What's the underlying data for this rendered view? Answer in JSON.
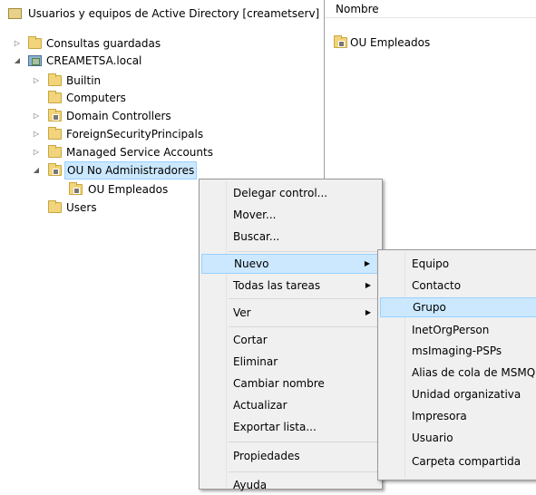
{
  "tree": {
    "root": "Usuarios y equipos de Active Directory [creametserv]",
    "saved_queries": "Consultas guardadas",
    "domain": "CREAMETSA.local",
    "builtin": "Builtin",
    "computers": "Computers",
    "domain_controllers": "Domain Controllers",
    "foreign": "ForeignSecurityPrincipals",
    "msa": "Managed Service Accounts",
    "ou_no_admin": "OU No Administradores",
    "ou_empleados": "OU Empleados",
    "users": "Users"
  },
  "list": {
    "column_name": "Nombre",
    "items": [
      "OU Empleados"
    ]
  },
  "context_menu": {
    "items": [
      "Delegar control...",
      "Mover...",
      "Buscar...",
      "Nuevo",
      "Todas las tareas",
      "Ver",
      "Cortar",
      "Eliminar",
      "Cambiar nombre",
      "Actualizar",
      "Exportar lista...",
      "Propiedades",
      "Ayuda"
    ],
    "highlighted": "Nuevo"
  },
  "submenu": {
    "items": [
      "Equipo",
      "Contacto",
      "Grupo",
      "InetOrgPerson",
      "msImaging-PSPs",
      "Alias de cola de MSMQ",
      "Unidad organizativa",
      "Impresora",
      "Usuario",
      "Carpeta compartida"
    ],
    "highlighted": "Grupo"
  },
  "icons": {
    "collapsed": "▷",
    "expanded": "◢",
    "submenu_arrow": "▶"
  }
}
